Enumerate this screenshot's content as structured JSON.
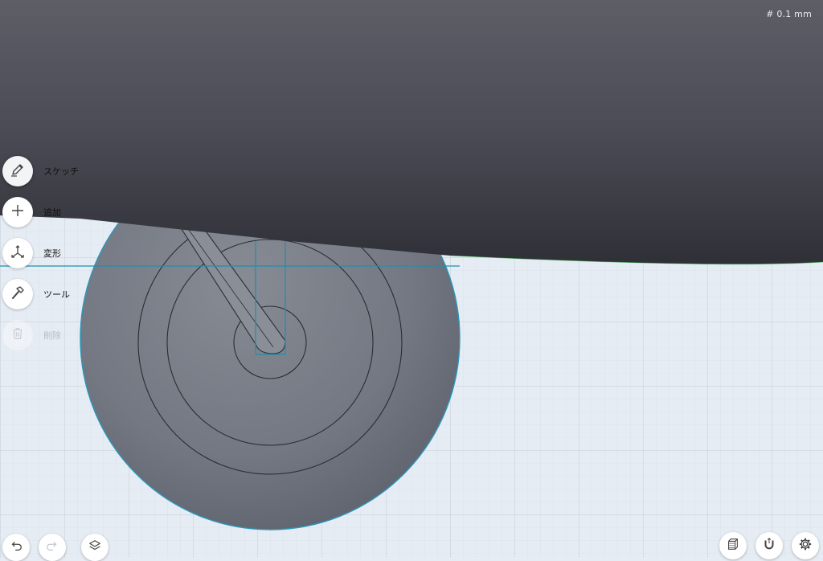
{
  "status": {
    "grid_size": "# 0.1 mm"
  },
  "toolbar": {
    "items": [
      {
        "label": "スケッチ",
        "icon": "pencil-icon",
        "state": "active"
      },
      {
        "label": "追加",
        "icon": "plus-icon",
        "state": "enabled"
      },
      {
        "label": "変形",
        "icon": "transform-icon",
        "state": "enabled"
      },
      {
        "label": "ツール",
        "icon": "hammer-icon",
        "state": "enabled"
      },
      {
        "label": "削除",
        "icon": "trash-icon",
        "state": "disabled"
      }
    ]
  },
  "bottom_left": {
    "buttons": [
      {
        "icon": "undo-icon",
        "state": "enabled"
      },
      {
        "icon": "redo-icon",
        "state": "disabled"
      },
      {
        "icon": "layers-icon",
        "state": "enabled"
      }
    ]
  },
  "bottom_right": {
    "buttons": [
      {
        "icon": "view-cube-icon"
      },
      {
        "icon": "magnet-icon"
      },
      {
        "icon": "gear-icon"
      }
    ]
  },
  "colors": {
    "grid_background": "#e6ecf3",
    "body_dark": "#4a4b55",
    "wheel_gray": "#7c808a",
    "selection_blue": "#1e8fb0"
  }
}
